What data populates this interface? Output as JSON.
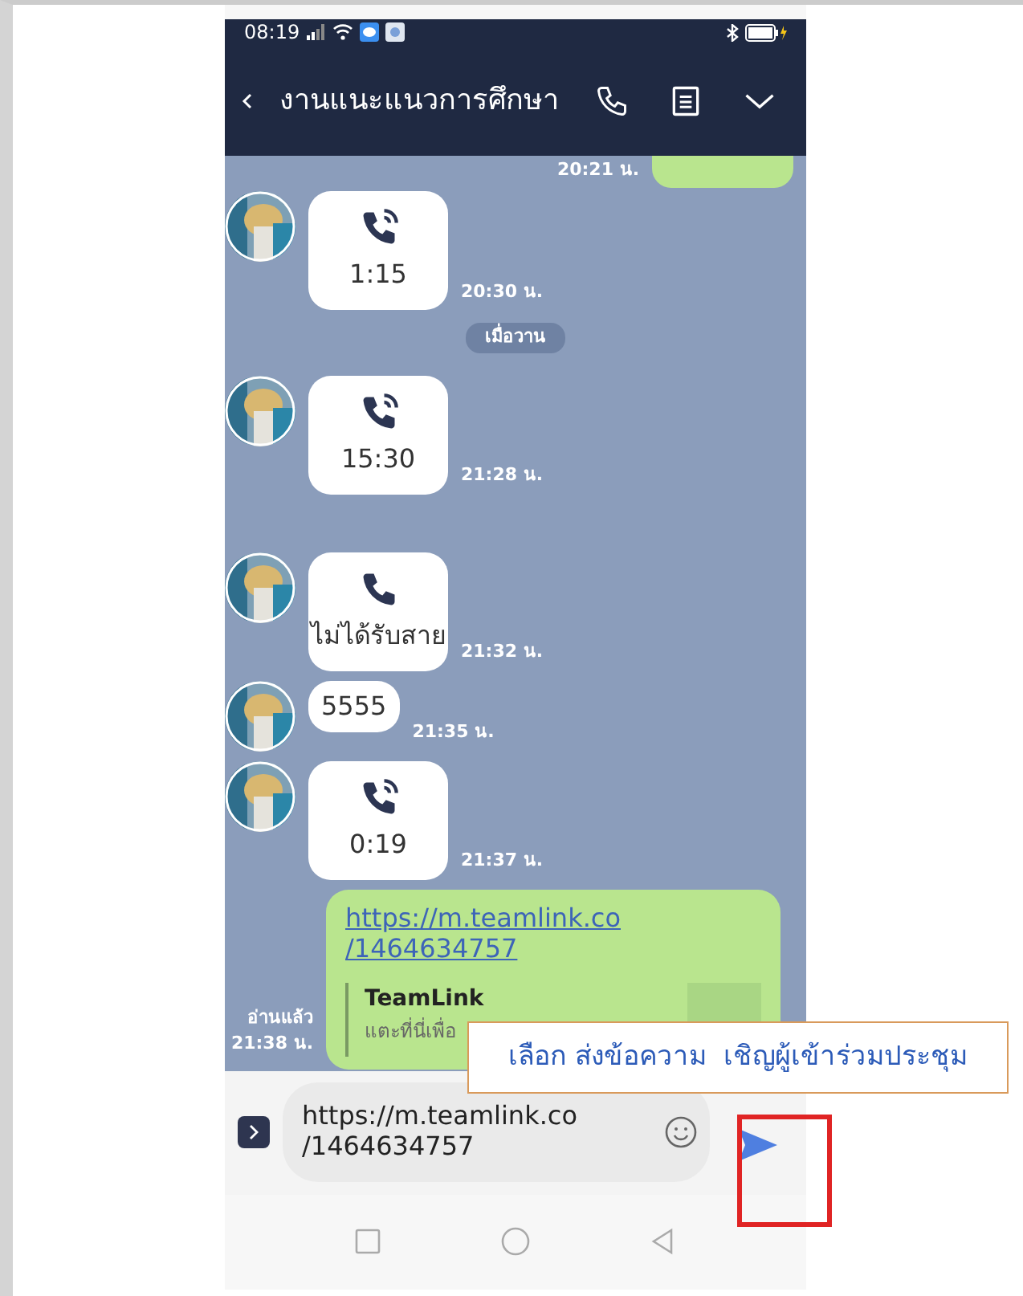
{
  "status_bar": {
    "time": "08:19"
  },
  "header": {
    "title": "งานแนะแนวการศึกษา"
  },
  "messages": [
    {
      "kind": "stub",
      "time": "20:21 น."
    },
    {
      "kind": "call",
      "missed": false,
      "text": "1:15",
      "time": "20:30 น."
    },
    {
      "kind": "date",
      "text": "เมื่อวาน"
    },
    {
      "kind": "call",
      "missed": false,
      "text": "15:30",
      "time": "21:28 น."
    },
    {
      "kind": "call",
      "missed": true,
      "text": "ไม่ได้รับสาย",
      "time": "21:32 น."
    },
    {
      "kind": "text",
      "text": "5555",
      "time": "21:35 น."
    },
    {
      "kind": "call",
      "missed": false,
      "text": "0:19",
      "time": "21:37 น."
    },
    {
      "kind": "link",
      "url_lines": [
        "https://m.teamlink.co",
        "/1464634757"
      ],
      "preview_title": "TeamLink",
      "preview_text": "แตะที่นี่เพื่อ",
      "read": "อ่านแล้ว",
      "time": "21:38 น."
    }
  ],
  "composer": {
    "value": "https://m.teamlink.co\n/1464634757"
  },
  "callout": "เลือก ส่งข้อความ  เชิญผู้เข้าร่วมประชุม"
}
